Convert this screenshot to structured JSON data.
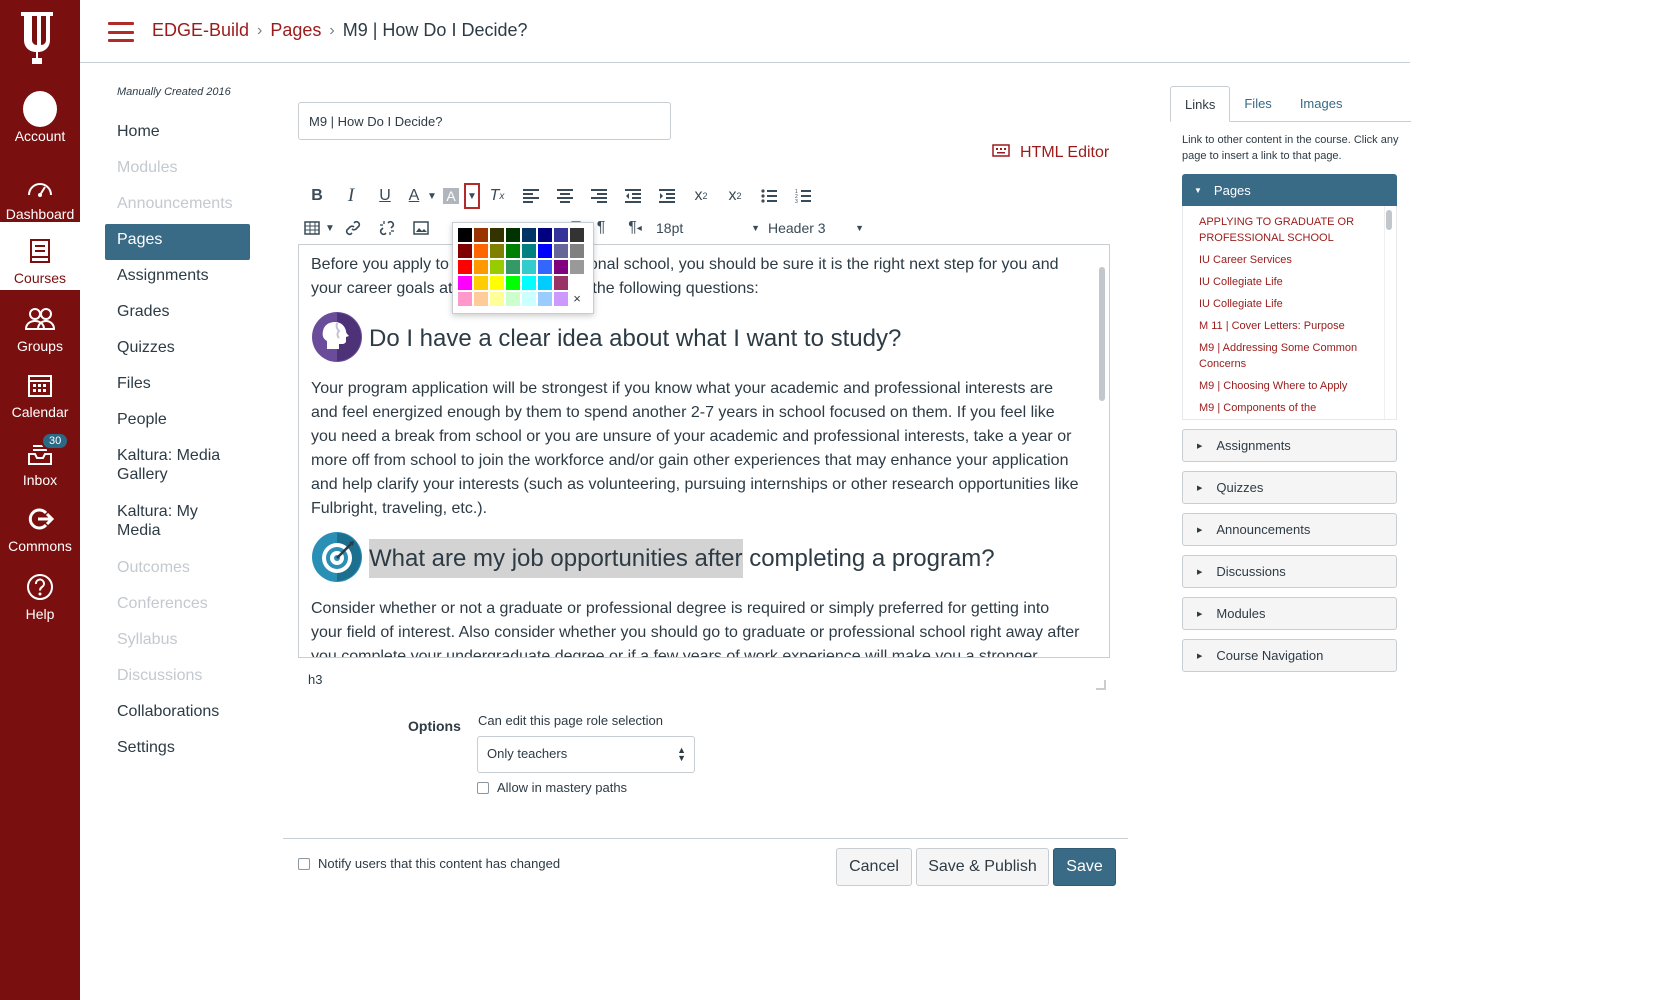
{
  "global_nav": {
    "items": [
      {
        "label": "Account",
        "icon": "account-avatar"
      },
      {
        "label": "Dashboard",
        "icon": "dashboard-icon"
      },
      {
        "label": "Courses",
        "icon": "courses-icon"
      },
      {
        "label": "Groups",
        "icon": "groups-icon"
      },
      {
        "label": "Calendar",
        "icon": "calendar-icon"
      },
      {
        "label": "Inbox",
        "icon": "inbox-icon",
        "badge": "30"
      },
      {
        "label": "Commons",
        "icon": "commons-icon"
      },
      {
        "label": "Help",
        "icon": "help-icon"
      }
    ],
    "active": "Courses",
    "color": "#7a0f0f"
  },
  "breadcrumb": {
    "course": "EDGE-Build",
    "section": "Pages",
    "current": "M9 | How Do I Decide?"
  },
  "course_nav": {
    "subtitle": "Manually Created 2016",
    "items": [
      {
        "label": "Home"
      },
      {
        "label": "Modules"
      },
      {
        "label": "Announcements"
      },
      {
        "label": "Pages"
      },
      {
        "label": "Assignments"
      },
      {
        "label": "Grades"
      },
      {
        "label": "Quizzes"
      },
      {
        "label": "Files"
      },
      {
        "label": "People"
      },
      {
        "label": "Kaltura: Media Gallery"
      },
      {
        "label": "Kaltura: My Media"
      },
      {
        "label": "Outcomes"
      },
      {
        "label": "Conferences"
      },
      {
        "label": "Syllabus"
      },
      {
        "label": "Discussions"
      },
      {
        "label": "Collaborations"
      },
      {
        "label": "Settings"
      }
    ]
  },
  "editor": {
    "title_value": "M9 | How Do I Decide?",
    "html_editor_label": "HTML Editor",
    "font_size": "18pt",
    "format": "Header 3",
    "p1_a": "Before you apply to",
    "p1_b": "onal school, you should be sure it is the right next step for you and",
    "p1_c": "your career goals at",
    "p1_d": "the following questions:",
    "h1": "Do I have a clear idea about what I want to study?",
    "p2": "Your program application will be strongest if you know what your academic and professional interests are and feel energized enough by them to spend another 2-7 years in school focused on them. If you feel like you need a break from school or you are unsure of your academic and professional interests, take a year or more off from school to join the workforce and/or gain other experiences that may enhance your application and help clarify your interests (such as volunteering, pursuing internships or other research opportunities like Fulbright, traveling, etc.).",
    "h2_selected": "What are my job opportunities after",
    "h2_rest": "completing a program?",
    "p3": "Consider whether or not a graduate or professional degree is required or simply preferred for getting into your field of interest. Also consider whether you should go to graduate or professional school right away after you complete your undergraduate degree or if a few years of work experience will make you a stronger applicant.",
    "status_path": "h3"
  },
  "palette": {
    "colors": [
      "#000000",
      "#993300",
      "#333300",
      "#003300",
      "#003366",
      "#000080",
      "#333399",
      "#333333",
      "#800000",
      "#ff6600",
      "#808000",
      "#008000",
      "#008080",
      "#0000ff",
      "#666699",
      "#808080",
      "#ff0000",
      "#ff9900",
      "#99cc00",
      "#339966",
      "#33cccc",
      "#3366ff",
      "#800080",
      "#999999",
      "#ff00ff",
      "#ffcc00",
      "#ffff00",
      "#00ff00",
      "#00ffff",
      "#00ccff",
      "#993366",
      "#ffffff",
      "#ff99cc",
      "#ffcc99",
      "#ffff99",
      "#ccffcc",
      "#ccffff",
      "#99ccff",
      "#cc99ff"
    ],
    "close": "×"
  },
  "options": {
    "label": "Options",
    "role_label": "Can edit this page role selection",
    "role_value": "Only teachers",
    "mastery_label": "Allow in mastery paths"
  },
  "footer": {
    "notify_label": "Notify users that this content has changed",
    "cancel": "Cancel",
    "save_publish": "Save & Publish",
    "save": "Save"
  },
  "sidebar": {
    "tabs": [
      "Links",
      "Files",
      "Images"
    ],
    "description": "Link to other content in the course. Click any page to insert a link to that page.",
    "open_section": "Pages",
    "pages": [
      "APPLYING TO GRADUATE OR PROFESSIONAL SCHOOL",
      "IU Career Services",
      "IU Collegiate Life",
      "IU Collegiate Life",
      "M 11 | Cover Letters: Purpose",
      "M9 | Addressing Some Common Concerns",
      "M9 | Choosing Where to Apply",
      "M9 | Components of the"
    ],
    "sections": [
      "Assignments",
      "Quizzes",
      "Announcements",
      "Discussions",
      "Modules",
      "Course Navigation"
    ]
  }
}
